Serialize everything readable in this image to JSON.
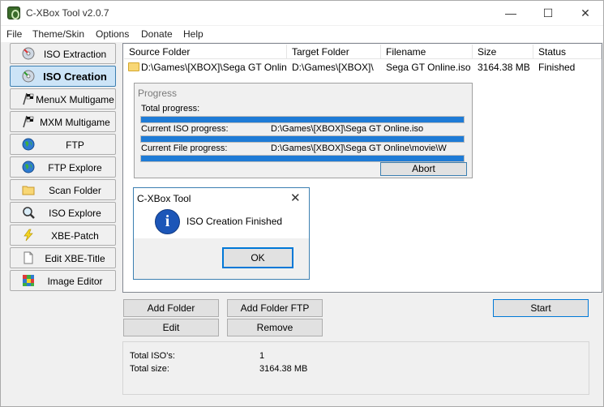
{
  "window": {
    "title": "C-XBox Tool v2.0.7",
    "controls": {
      "minimize": "—",
      "maximize": "☐",
      "close": "✕"
    }
  },
  "menu": [
    "File",
    "Theme/Skin",
    "Options",
    "Donate",
    "Help"
  ],
  "sidebar": {
    "items": [
      {
        "label": "ISO Extraction",
        "icon": "disc-icon",
        "active": false
      },
      {
        "label": "ISO Creation",
        "icon": "disc-icon",
        "active": true
      },
      {
        "label": "MenuX Multigame",
        "icon": "flag-icon",
        "active": false
      },
      {
        "label": "MXM Multigame",
        "icon": "flag-icon",
        "active": false
      },
      {
        "label": "FTP",
        "icon": "globe-icon",
        "active": false
      },
      {
        "label": "FTP Explore",
        "icon": "globe-icon",
        "active": false
      },
      {
        "label": "Scan Folder",
        "icon": "folder-icon",
        "active": false
      },
      {
        "label": "ISO Explore",
        "icon": "magnifier-icon",
        "active": false
      },
      {
        "label": "XBE-Patch",
        "icon": "lightning-icon",
        "active": false
      },
      {
        "label": "Edit XBE-Title",
        "icon": "document-icon",
        "active": false
      },
      {
        "label": "Image Editor",
        "icon": "image-icon",
        "active": false
      }
    ]
  },
  "table": {
    "columns": [
      "Source Folder",
      "Target Folder",
      "Filename",
      "Size",
      "Status"
    ],
    "rows": [
      {
        "source": "D:\\Games\\[XBOX]\\Sega GT Online",
        "target": "D:\\Games\\[XBOX]\\",
        "filename": "Sega GT Online.iso",
        "size": "3164.38 MB",
        "status": "Finished"
      }
    ]
  },
  "progress": {
    "title": "Progress",
    "total_label": "Total progress:",
    "total_fraction": 1.0,
    "iso_label": "Current ISO progress:",
    "iso_path": "D:\\Games\\[XBOX]\\Sega GT Online.iso",
    "iso_fraction": 1.0,
    "file_label": "Current File progress:",
    "file_path": "D:\\Games\\[XBOX]\\Sega GT Online\\movie\\W",
    "file_fraction": 1.0,
    "abort_label": "Abort"
  },
  "dialog": {
    "title": "C-XBox Tool",
    "close": "✕",
    "message": "ISO Creation Finished",
    "ok_label": "OK",
    "icon_glyph": "i"
  },
  "buttons": {
    "add_folder": "Add Folder",
    "add_folder_ftp": "Add Folder FTP",
    "edit": "Edit",
    "remove": "Remove",
    "start": "Start"
  },
  "stats": {
    "total_isos_label": "Total ISO's:",
    "total_isos_value": "1",
    "total_size_label": "Total size:",
    "total_size_value": "3164.38 MB"
  }
}
